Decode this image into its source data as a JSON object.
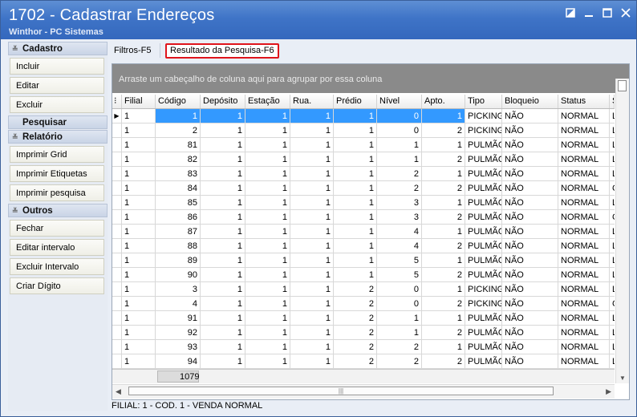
{
  "window": {
    "title": "1702 - Cadastrar Endereços",
    "subtitle": "Winthor - PC Sistemas"
  },
  "sidebar": {
    "sections": [
      {
        "title": "Cadastro",
        "buttons": [
          "Incluir",
          "Editar",
          "Excluir"
        ]
      },
      {
        "title": "Pesquisar",
        "buttons": []
      },
      {
        "title": "Relatório",
        "buttons": [
          "Imprimir Grid",
          "Imprimir Etiquetas",
          "Imprimir pesquisa"
        ]
      },
      {
        "title": "Outros",
        "buttons": [
          "Fechar",
          "Editar intervalo",
          "Excluir Intervalo",
          "Criar Dígito"
        ]
      }
    ]
  },
  "tabs": {
    "filters": "Filtros-F5",
    "results": "Resultado da Pesquisa-F6"
  },
  "grid": {
    "group_hint": "Arraste um cabeçalho de coluna aqui para agrupar por essa coluna",
    "columns": [
      "Filial",
      "Código",
      "Depósito",
      "Estação",
      "Rua.",
      "Prédio",
      "Nível",
      "Apto.",
      "Tipo",
      "Bloqueio",
      "Status",
      "S"
    ],
    "rows": [
      [
        "1",
        "1",
        "1",
        "1",
        "1",
        "1",
        "0",
        "1",
        "PICKING",
        "NÃO",
        "NORMAL",
        "L"
      ],
      [
        "1",
        "2",
        "1",
        "1",
        "1",
        "1",
        "0",
        "2",
        "PICKING",
        "NÃO",
        "NORMAL",
        "L"
      ],
      [
        "1",
        "81",
        "1",
        "1",
        "1",
        "1",
        "1",
        "1",
        "PULMÃO",
        "NÃO",
        "NORMAL",
        "L"
      ],
      [
        "1",
        "82",
        "1",
        "1",
        "1",
        "1",
        "1",
        "2",
        "PULMÃO",
        "NÃO",
        "NORMAL",
        "L"
      ],
      [
        "1",
        "83",
        "1",
        "1",
        "1",
        "1",
        "2",
        "1",
        "PULMÃO",
        "NÃO",
        "NORMAL",
        "L"
      ],
      [
        "1",
        "84",
        "1",
        "1",
        "1",
        "1",
        "2",
        "2",
        "PULMÃO",
        "NÃO",
        "NORMAL",
        "C"
      ],
      [
        "1",
        "85",
        "1",
        "1",
        "1",
        "1",
        "3",
        "1",
        "PULMÃO",
        "NÃO",
        "NORMAL",
        "L"
      ],
      [
        "1",
        "86",
        "1",
        "1",
        "1",
        "1",
        "3",
        "2",
        "PULMÃO",
        "NÃO",
        "NORMAL",
        "C"
      ],
      [
        "1",
        "87",
        "1",
        "1",
        "1",
        "1",
        "4",
        "1",
        "PULMÃO",
        "NÃO",
        "NORMAL",
        "L"
      ],
      [
        "1",
        "88",
        "1",
        "1",
        "1",
        "1",
        "4",
        "2",
        "PULMÃO",
        "NÃO",
        "NORMAL",
        "L"
      ],
      [
        "1",
        "89",
        "1",
        "1",
        "1",
        "1",
        "5",
        "1",
        "PULMÃO",
        "NÃO",
        "NORMAL",
        "L"
      ],
      [
        "1",
        "90",
        "1",
        "1",
        "1",
        "1",
        "5",
        "2",
        "PULMÃO",
        "NÃO",
        "NORMAL",
        "L"
      ],
      [
        "1",
        "3",
        "1",
        "1",
        "1",
        "2",
        "0",
        "1",
        "PICKING",
        "NÃO",
        "NORMAL",
        "L"
      ],
      [
        "1",
        "4",
        "1",
        "1",
        "1",
        "2",
        "0",
        "2",
        "PICKING",
        "NÃO",
        "NORMAL",
        "C"
      ],
      [
        "1",
        "91",
        "1",
        "1",
        "1",
        "2",
        "1",
        "1",
        "PULMÃO",
        "NÃO",
        "NORMAL",
        "L"
      ],
      [
        "1",
        "92",
        "1",
        "1",
        "1",
        "2",
        "1",
        "2",
        "PULMÃO",
        "NÃO",
        "NORMAL",
        "L"
      ],
      [
        "1",
        "93",
        "1",
        "1",
        "1",
        "2",
        "2",
        "1",
        "PULMÃO",
        "NÃO",
        "NORMAL",
        "L"
      ],
      [
        "1",
        "94",
        "1",
        "1",
        "1",
        "2",
        "2",
        "2",
        "PULMÃO",
        "NÃO",
        "NORMAL",
        "L"
      ]
    ],
    "total": "1079"
  },
  "status": "FILIAL: 1 - COD. 1 - VENDA NORMAL",
  "colors": {
    "titlebar": "#3f74c7",
    "selection": "#3399ff",
    "tab_highlight": "#e0141b"
  }
}
